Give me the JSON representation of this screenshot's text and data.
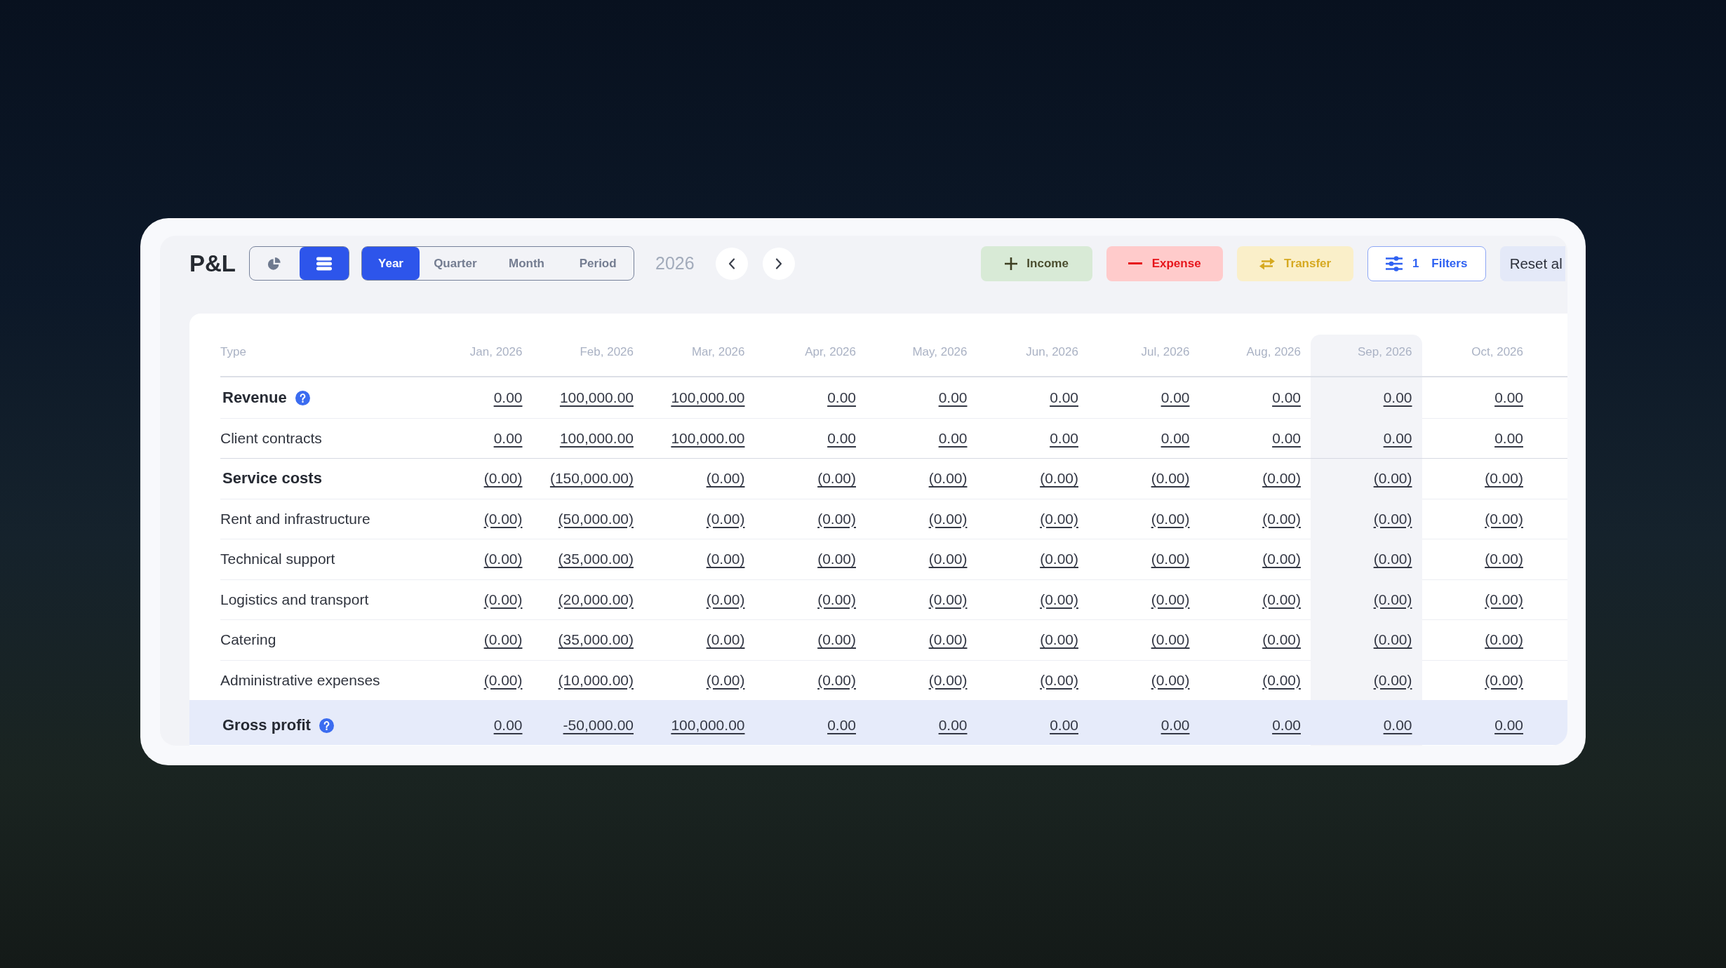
{
  "header": {
    "title": "P&L",
    "view_toggle": [
      {
        "kind": "chart",
        "selected": false
      },
      {
        "kind": "table",
        "selected": true
      }
    ],
    "period_tabs": [
      {
        "label": "Year",
        "selected": true
      },
      {
        "label": "Quarter",
        "selected": false
      },
      {
        "label": "Month",
        "selected": false
      },
      {
        "label": "Period",
        "selected": false
      }
    ],
    "year": "2026",
    "actions": [
      {
        "kind": "income",
        "label": "Income"
      },
      {
        "kind": "expense",
        "label": "Expense"
      },
      {
        "kind": "transfer",
        "label": "Transfer"
      },
      {
        "kind": "filters",
        "count": "1",
        "label": "Filters"
      },
      {
        "kind": "reset",
        "label": "Reset al"
      }
    ]
  },
  "table": {
    "type_label": "Type",
    "columns": [
      {
        "label": "Jan, 2026",
        "selected": false
      },
      {
        "label": "Feb, 2026",
        "selected": false
      },
      {
        "label": "Mar, 2026",
        "selected": false
      },
      {
        "label": "Apr, 2026",
        "selected": false
      },
      {
        "label": "May, 2026",
        "selected": false
      },
      {
        "label": "Jun, 2026",
        "selected": false
      },
      {
        "label": "Jul, 2026",
        "selected": false
      },
      {
        "label": "Aug, 2026",
        "selected": false
      },
      {
        "label": "Sep, 2026",
        "selected": true
      },
      {
        "label": "Oct, 2026",
        "selected": false
      }
    ],
    "rows": [
      {
        "kind": "section",
        "label": "Revenue",
        "help": true,
        "values": [
          "0.00",
          "100,000.00",
          "100,000.00",
          "0.00",
          "0.00",
          "0.00",
          "0.00",
          "0.00",
          "0.00",
          "0.00"
        ]
      },
      {
        "kind": "item",
        "label": "Client contracts",
        "help": false,
        "values": [
          "0.00",
          "100,000.00",
          "100,000.00",
          "0.00",
          "0.00",
          "0.00",
          "0.00",
          "0.00",
          "0.00",
          "0.00"
        ]
      },
      {
        "kind": "section",
        "label": "Service costs",
        "help": false,
        "values": [
          "(0.00)",
          "(150,000.00)",
          "(0.00)",
          "(0.00)",
          "(0.00)",
          "(0.00)",
          "(0.00)",
          "(0.00)",
          "(0.00)",
          "(0.00)"
        ]
      },
      {
        "kind": "item",
        "label": "Rent and infrastructure",
        "help": false,
        "values": [
          "(0.00)",
          "(50,000.00)",
          "(0.00)",
          "(0.00)",
          "(0.00)",
          "(0.00)",
          "(0.00)",
          "(0.00)",
          "(0.00)",
          "(0.00)"
        ]
      },
      {
        "kind": "item",
        "label": "Technical support",
        "help": false,
        "values": [
          "(0.00)",
          "(35,000.00)",
          "(0.00)",
          "(0.00)",
          "(0.00)",
          "(0.00)",
          "(0.00)",
          "(0.00)",
          "(0.00)",
          "(0.00)"
        ]
      },
      {
        "kind": "item",
        "label": "Logistics and transport",
        "help": false,
        "values": [
          "(0.00)",
          "(20,000.00)",
          "(0.00)",
          "(0.00)",
          "(0.00)",
          "(0.00)",
          "(0.00)",
          "(0.00)",
          "(0.00)",
          "(0.00)"
        ]
      },
      {
        "kind": "item",
        "label": "Catering",
        "help": false,
        "values": [
          "(0.00)",
          "(35,000.00)",
          "(0.00)",
          "(0.00)",
          "(0.00)",
          "(0.00)",
          "(0.00)",
          "(0.00)",
          "(0.00)",
          "(0.00)"
        ]
      },
      {
        "kind": "item",
        "label": "Administrative expenses",
        "help": false,
        "values": [
          "(0.00)",
          "(10,000.00)",
          "(0.00)",
          "(0.00)",
          "(0.00)",
          "(0.00)",
          "(0.00)",
          "(0.00)",
          "(0.00)",
          "(0.00)"
        ]
      },
      {
        "kind": "total",
        "label": "Gross profit",
        "help": true,
        "values": [
          "0.00",
          "-50,000.00",
          "100,000.00",
          "0.00",
          "0.00",
          "0.00",
          "0.00",
          "0.00",
          "0.00",
          "0.00"
        ]
      }
    ]
  }
}
